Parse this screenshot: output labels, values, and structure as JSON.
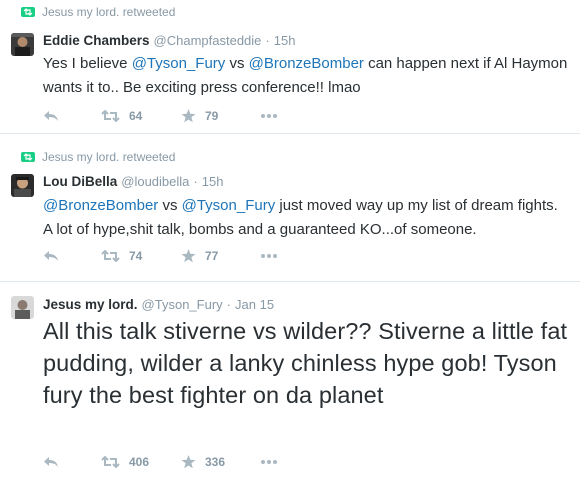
{
  "tweets": [
    {
      "retweeted_by": "Jesus my lord. retweeted",
      "name": "Eddie Chambers",
      "handle": "@Champfasteddie",
      "time": "15h",
      "text_parts": [
        "Yes I believe ",
        "@Tyson_Fury",
        " vs ",
        "@BronzeBomber",
        " can happen next if Al Haymon wants it to.. Be exciting press conference!! lmao"
      ],
      "retweets": "64",
      "favorites": "79"
    },
    {
      "retweeted_by": "Jesus my lord. retweeted",
      "name": "Lou DiBella",
      "handle": "@loudibella",
      "time": "15h",
      "text_parts": [
        "@BronzeBomber",
        " vs ",
        "@Tyson_Fury",
        " just moved way up my list of dream fights. A lot of hype,shit talk, bombs and a guaranteed KO...of someone."
      ],
      "retweets": "74",
      "favorites": "77"
    },
    {
      "name": "Jesus my lord.",
      "handle": "@Tyson_Fury",
      "time": "Jan 15",
      "text": "All this talk stiverne vs wilder?? Stiverne a little fat pudding, wilder a lanky chinless hype gob! Tyson fury the best fighter on da planet",
      "retweets": "406",
      "favorites": "336"
    }
  ],
  "colors": {
    "mention": "#1e75b8",
    "muted": "#8899a6",
    "retweet_green": "#19cf86",
    "text": "#292f33",
    "divider": "#e1e8ed"
  },
  "icons": {
    "retweeted_badge": "retweet-badge-icon",
    "reply": "reply-icon",
    "retweet": "retweet-icon",
    "favorite": "star-icon",
    "more": "more-dots-icon"
  }
}
